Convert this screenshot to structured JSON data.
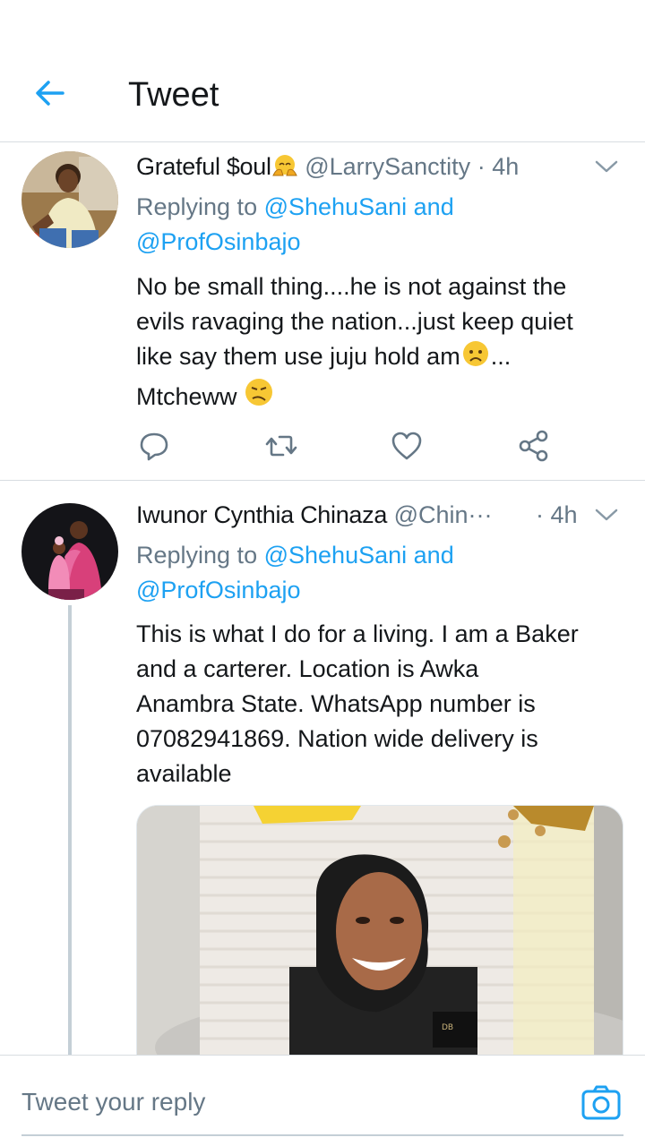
{
  "header": {
    "title": "Tweet",
    "back_icon": "arrow-left-icon"
  },
  "tweets": [
    {
      "display_name": "Grateful $oul",
      "name_emoji": "crying-face-hands-emoji",
      "handle": "@LarrySanctity",
      "separator": "·",
      "time": "4h",
      "replying_prefix": "Replying to",
      "replying_to_1": "@ShehuSani",
      "replying_and": "and",
      "replying_to_2": "@ProfOsinbajo",
      "text_line1": "No be small thing....he is not against the",
      "text_line2": "evils ravaging the nation...just keep quiet",
      "text_line3a": "like say them use juju hold am",
      "text_line3b": "...",
      "text_line4": "Mtcheww",
      "actions": [
        "reply-icon",
        "retweet-icon",
        "like-icon",
        "share-icon"
      ]
    },
    {
      "display_name": "Iwunor Cynthia Chinaza",
      "handle": "@Chin···",
      "separator": "·",
      "time": "4h",
      "replying_prefix": "Replying to",
      "replying_to_1": "@ShehuSani",
      "replying_and": "and",
      "replying_to_2": "@ProfOsinbajo",
      "text_line1": "This is what I do for a living. I am a Baker",
      "text_line2": "and a carterer. Location is Awka",
      "text_line3": "Anambra State. WhatsApp number is",
      "text_line4": "07082941869. Nation wide delivery is",
      "text_line5": "available",
      "media": "photo-cake-with-portrait"
    }
  ],
  "reply_bar": {
    "placeholder": "Tweet your reply",
    "camera_icon": "camera-icon"
  },
  "colors": {
    "accent": "#1da1f2",
    "text": "#14171a",
    "secondary": "#657786",
    "divider": "#d8dde1"
  }
}
